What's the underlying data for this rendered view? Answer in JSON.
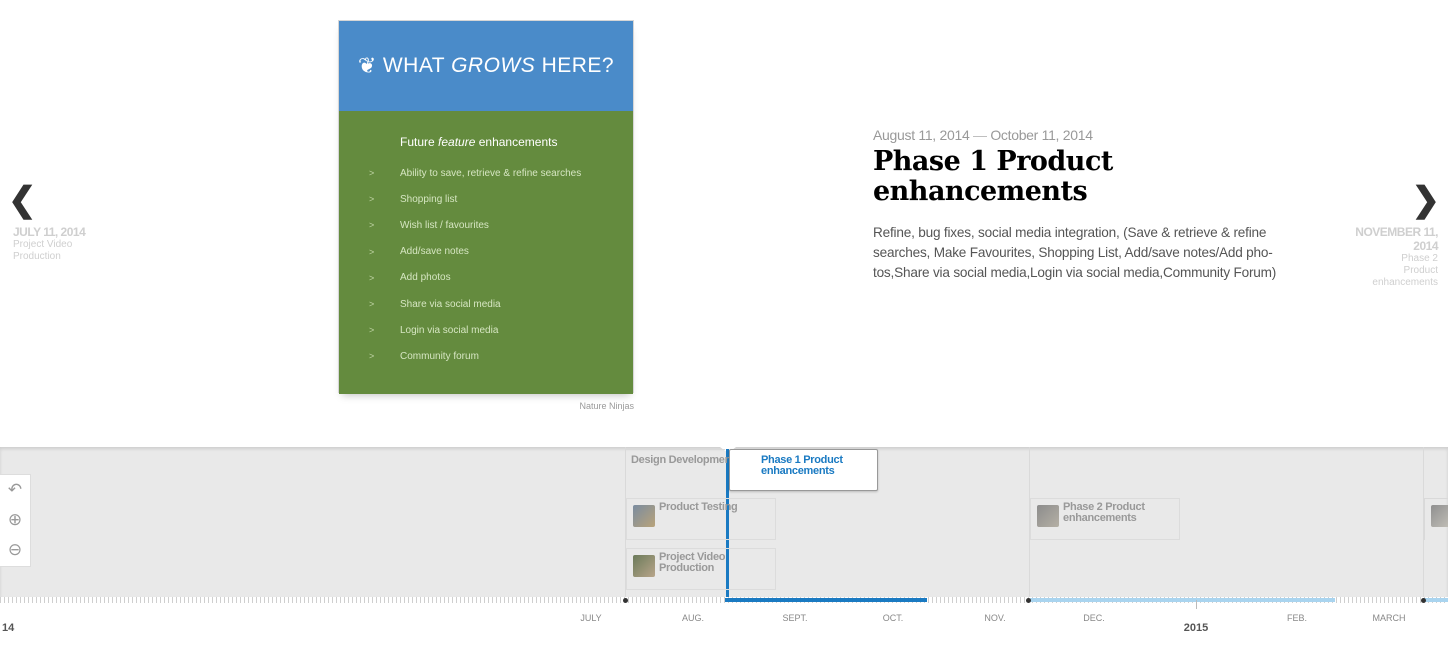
{
  "slider": {
    "prev": {
      "date": "JULY 11, 2014",
      "title": "Project Video Production"
    },
    "next": {
      "date": "NOVEMBER 11, 2014",
      "title": "Phase 2 Product enhancements"
    },
    "media": {
      "poster_title_a": "WHAT",
      "poster_title_b": "GROWS",
      "poster_title_c": "HERE?",
      "heading_a": "Future",
      "heading_b": "feature",
      "heading_c": "enhancements",
      "items": [
        "Ability to save, retrieve & refine searches",
        "Shopping list",
        "Wish list / favourites",
        "Add/save notes",
        "Add photos",
        "Share via social media",
        "Login via social media",
        "Community forum"
      ],
      "credit": "Nature Ninjas"
    },
    "slide": {
      "start_date": "August 11, 2014",
      "dash": "—",
      "end_date": "October 11, 2014",
      "title": "Phase 1 Product enhancements",
      "description": "Refine, bug fixes, social media integration, (Save & retrieve & refine searches, Make Favourites, Shopping List, Add/save notes/Add pho-tos,Share via social media,Login via social media,Community Forum)"
    }
  },
  "timenav": {
    "markers": {
      "design": "Design Development",
      "phase1": "Phase 1 Product enhancements",
      "testing": "Product Testing",
      "video": "Project Video Production",
      "phase2": "Phase 2 Product enhancements"
    },
    "months": [
      "JULY",
      "AUG.",
      "SEPT.",
      "OCT.",
      "NOV.",
      "DEC.",
      "FEB.",
      "MARCH"
    ],
    "years": {
      "left": "14",
      "mid": "2015"
    }
  },
  "colors": {
    "poster_blue": "#4a8bc9",
    "poster_green": "#648b3e",
    "active_blue": "#1a7ac2",
    "era_light_blue": "#a9d4ef"
  }
}
